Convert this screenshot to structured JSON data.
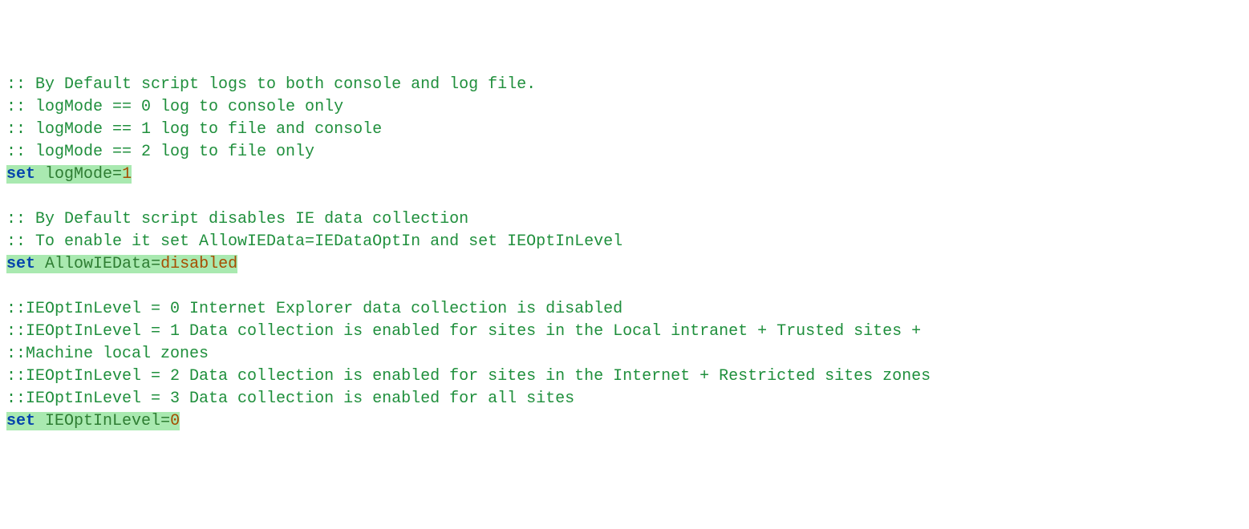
{
  "lines": {
    "c1": ":: By Default script logs to both console and log file.",
    "c2": ":: logMode == 0 log to console only",
    "c3": ":: logMode == 1 log to file and console",
    "c4": ":: logMode == 2 log to file only",
    "set1": {
      "kw": "set",
      "var": "logMode",
      "op": "=",
      "val": "1"
    },
    "c5": ":: By Default script disables IE data collection",
    "c6": ":: To enable it set AllowIEData=IEDataOptIn and set IEOptInLevel",
    "set2": {
      "kw": "set",
      "var": "AllowIEData",
      "op": "=",
      "val": "disabled"
    },
    "c7": "::IEOptInLevel = 0 Internet Explorer data collection is disabled",
    "c8": "::IEOptInLevel = 1 Data collection is enabled for sites in the Local intranet + Trusted sites +",
    "c9": "::Machine local zones",
    "c10": "::IEOptInLevel = 2 Data collection is enabled for sites in the Internet + Restricted sites zones",
    "c11": "::IEOptInLevel = 3 Data collection is enabled for all sites",
    "set3": {
      "kw": "set",
      "var": "IEOptInLevel",
      "op": "=",
      "val": "0"
    }
  }
}
